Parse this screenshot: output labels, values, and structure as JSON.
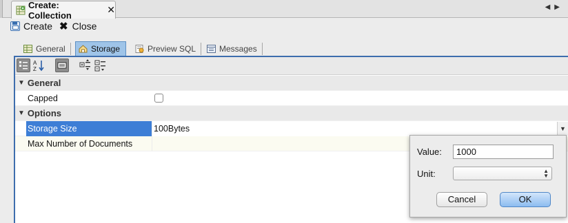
{
  "editor_tab": {
    "title": "Create: Collection",
    "close": "✕"
  },
  "actions": {
    "create_label": "Create",
    "close_label": "Close"
  },
  "subtabs": [
    {
      "label": "General",
      "icon": "table-icon"
    },
    {
      "label": "Storage",
      "icon": "storage-icon",
      "active": true
    },
    {
      "label": "Preview SQL",
      "icon": "sql-icon"
    },
    {
      "label": "Messages",
      "icon": "messages-icon"
    }
  ],
  "property_grid": {
    "general_category": "General",
    "capped_label": "Capped",
    "capped_checked": false,
    "options_category": "Options",
    "storage_size_label": "Storage Size",
    "storage_size_value": "100Bytes",
    "max_docs_label": "Max Number of Documents"
  },
  "popup": {
    "value_label": "Value:",
    "value": "1000",
    "unit_label": "Unit:",
    "unit_value": "",
    "cancel_label": "Cancel",
    "ok_label": "OK"
  },
  "colors": {
    "selection": "#3d7ed6",
    "accent": "#3d6dad"
  }
}
